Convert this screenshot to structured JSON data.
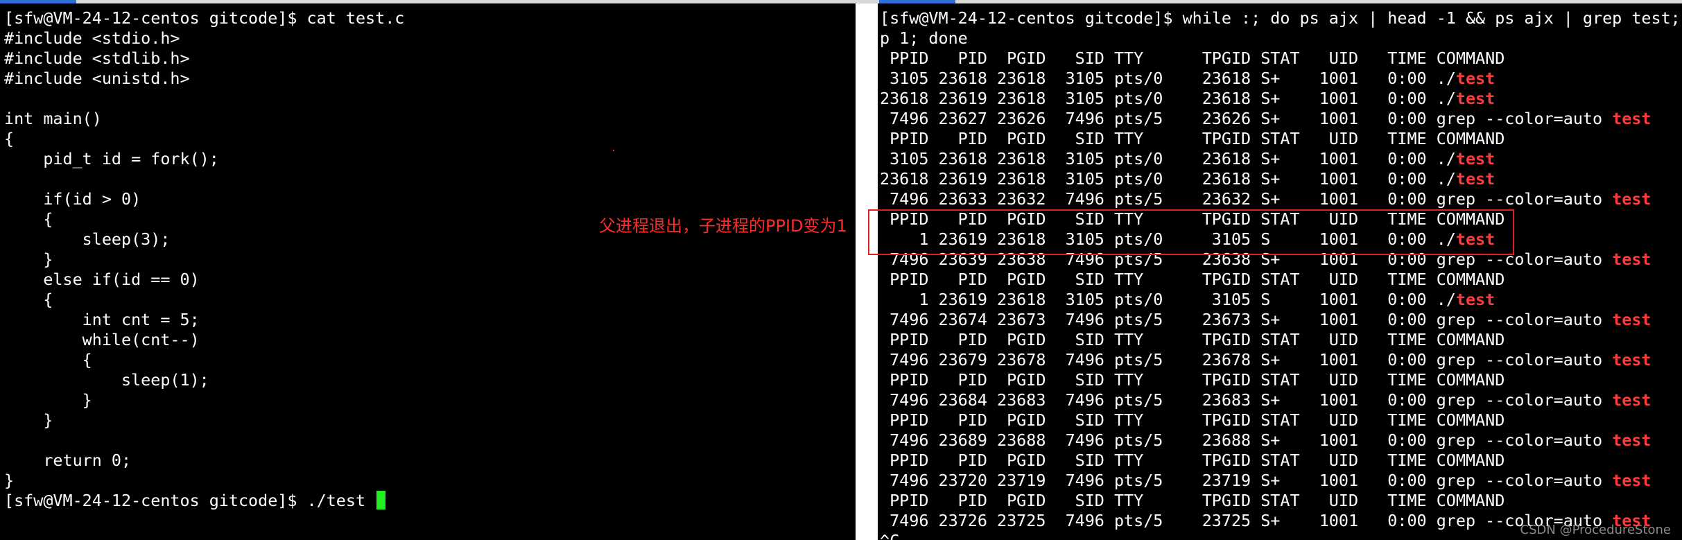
{
  "left_terminal": {
    "lines": [
      "[sfw@VM-24-12-centos gitcode]$ cat test.c",
      "#include <stdio.h>",
      "#include <stdlib.h>",
      "#include <unistd.h>",
      "",
      "int main()",
      "{",
      "    pid_t id = fork();",
      "",
      "    if(id > 0)",
      "    {",
      "        sleep(3);",
      "    }",
      "    else if(id == 0)",
      "    {",
      "        int cnt = 5;",
      "        while(cnt--)",
      "        {",
      "            sleep(1);",
      "        }",
      "    }",
      "",
      "    return 0;",
      "}"
    ],
    "prompt_line": "[sfw@VM-24-12-centos gitcode]$ ./test "
  },
  "right_terminal": {
    "lines": [
      {
        "pre": "[sfw@VM-24-12-centos gitcode]$ while :; do ps ajx | head -1 && ps ajx | grep test;",
        "hl": ""
      },
      {
        "pre": "p 1; done",
        "hl": ""
      },
      {
        "pre": " PPID   PID  PGID   SID TTY      TPGID STAT   UID   TIME COMMAND",
        "hl": ""
      },
      {
        "pre": " 3105 23618 23618  3105 pts/0    23618 S+    1001   0:00 ./",
        "hl": "test"
      },
      {
        "pre": "23618 23619 23618  3105 pts/0    23618 S+    1001   0:00 ./",
        "hl": "test"
      },
      {
        "pre": " 7496 23627 23626  7496 pts/5    23626 S+    1001   0:00 grep --color=auto ",
        "hl": "test"
      },
      {
        "pre": " PPID   PID  PGID   SID TTY      TPGID STAT   UID   TIME COMMAND",
        "hl": ""
      },
      {
        "pre": " 3105 23618 23618  3105 pts/0    23618 S+    1001   0:00 ./",
        "hl": "test"
      },
      {
        "pre": "23618 23619 23618  3105 pts/0    23618 S+    1001   0:00 ./",
        "hl": "test"
      },
      {
        "pre": " 7496 23633 23632  7496 pts/5    23632 S+    1001   0:00 grep --color=auto ",
        "hl": "test"
      },
      {
        "pre": " PPID   PID  PGID   SID TTY      TPGID STAT   UID   TIME COMMAND",
        "hl": ""
      },
      {
        "pre": "    1 23619 23618  3105 pts/0     3105 S     1001   0:00 ./",
        "hl": "test"
      },
      {
        "pre": " 7496 23639 23638  7496 pts/5    23638 S+    1001   0:00 grep --color=auto ",
        "hl": "test"
      },
      {
        "pre": " PPID   PID  PGID   SID TTY      TPGID STAT   UID   TIME COMMAND",
        "hl": ""
      },
      {
        "pre": "    1 23619 23618  3105 pts/0     3105 S     1001   0:00 ./",
        "hl": "test"
      },
      {
        "pre": " 7496 23674 23673  7496 pts/5    23673 S+    1001   0:00 grep --color=auto ",
        "hl": "test"
      },
      {
        "pre": " PPID   PID  PGID   SID TTY      TPGID STAT   UID   TIME COMMAND",
        "hl": ""
      },
      {
        "pre": " 7496 23679 23678  7496 pts/5    23678 S+    1001   0:00 grep --color=auto ",
        "hl": "test"
      },
      {
        "pre": " PPID   PID  PGID   SID TTY      TPGID STAT   UID   TIME COMMAND",
        "hl": ""
      },
      {
        "pre": " 7496 23684 23683  7496 pts/5    23683 S+    1001   0:00 grep --color=auto ",
        "hl": "test"
      },
      {
        "pre": " PPID   PID  PGID   SID TTY      TPGID STAT   UID   TIME COMMAND",
        "hl": ""
      },
      {
        "pre": " 7496 23689 23688  7496 pts/5    23688 S+    1001   0:00 grep --color=auto ",
        "hl": "test"
      },
      {
        "pre": " PPID   PID  PGID   SID TTY      TPGID STAT   UID   TIME COMMAND",
        "hl": ""
      },
      {
        "pre": " 7496 23720 23719  7496 pts/5    23719 S+    1001   0:00 grep --color=auto ",
        "hl": "test"
      },
      {
        "pre": " PPID   PID  PGID   SID TTY      TPGID STAT   UID   TIME COMMAND",
        "hl": ""
      },
      {
        "pre": " 7496 23726 23725  7496 pts/5    23725 S+    1001   0:00 grep --color=auto ",
        "hl": "test"
      },
      {
        "pre": "^C",
        "hl": ""
      }
    ]
  },
  "annotation": {
    "text": "父进程退出，子进程的PPID变为1",
    "color": "#ff2a2a"
  },
  "watermark": "CSDN @ProcedureStone",
  "colors": {
    "terminal_bg": "#000000",
    "terminal_fg": "#ffffff",
    "grep_highlight": "#ff3b3b",
    "cursor": "#22ee22"
  }
}
